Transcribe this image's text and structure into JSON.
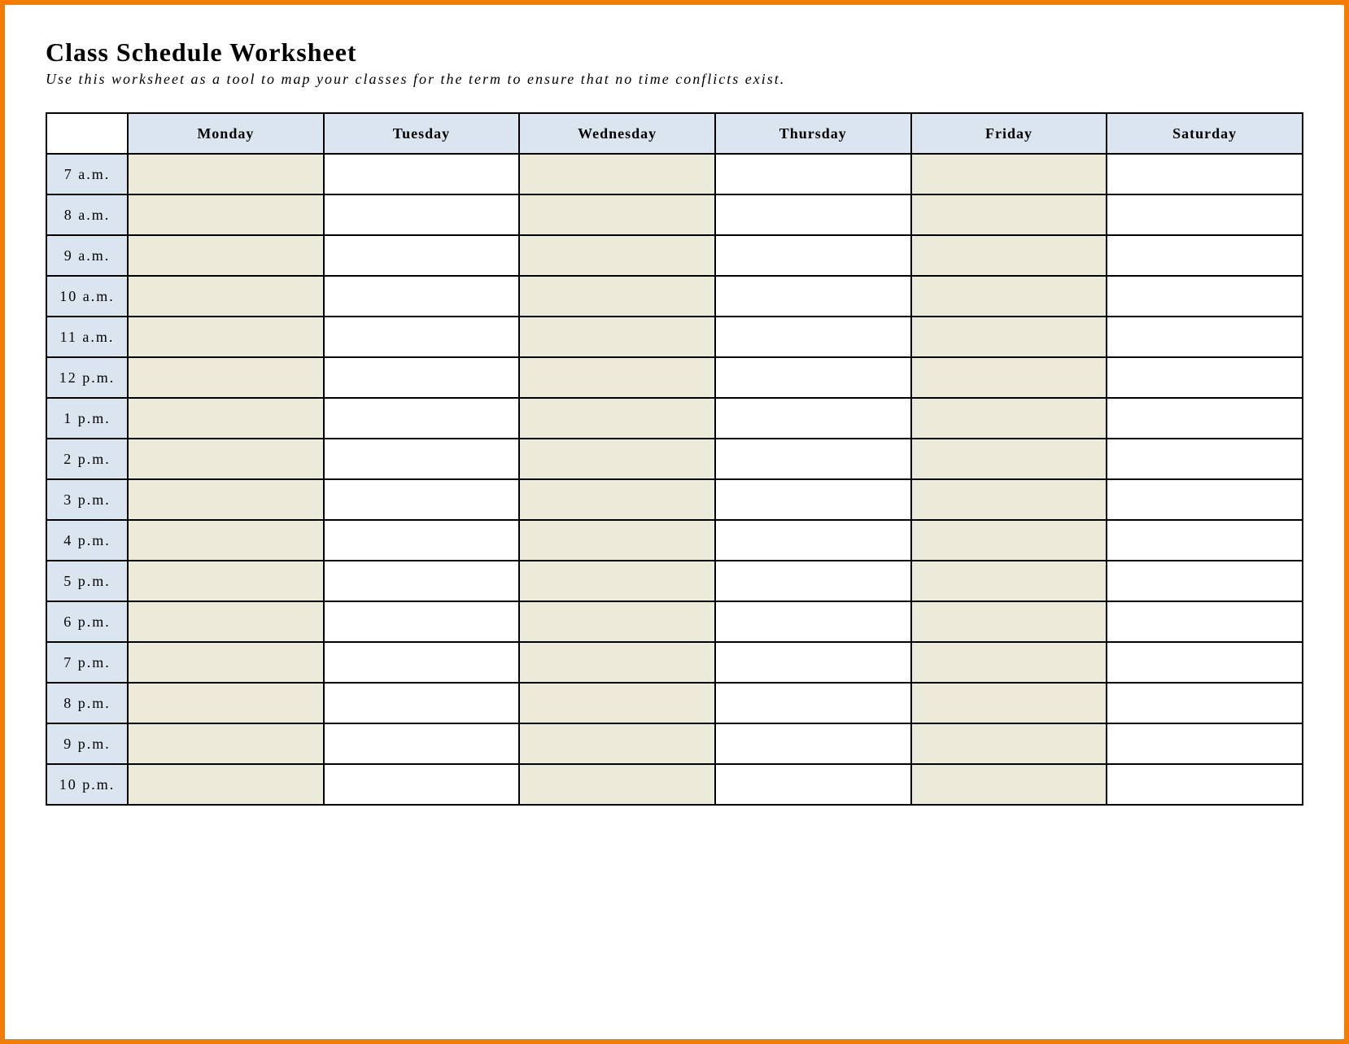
{
  "title": "Class Schedule Worksheet",
  "subtitle": "Use this worksheet as a tool to map your classes for the term to ensure that no time conflicts exist.",
  "days": [
    "Monday",
    "Tuesday",
    "Wednesday",
    "Thursday",
    "Friday",
    "Saturday"
  ],
  "times": [
    "7 a.m.",
    "8 a.m.",
    "9 a.m.",
    "10 a.m.",
    "11 a.m.",
    "12 p.m.",
    "1 p.m.",
    "2 p.m.",
    "3 p.m.",
    "4 p.m.",
    "5 p.m.",
    "6 p.m.",
    "7 p.m.",
    "8 p.m.",
    "9 p.m.",
    "10 p.m."
  ],
  "shaded_day_indices": [
    0,
    2,
    4
  ]
}
